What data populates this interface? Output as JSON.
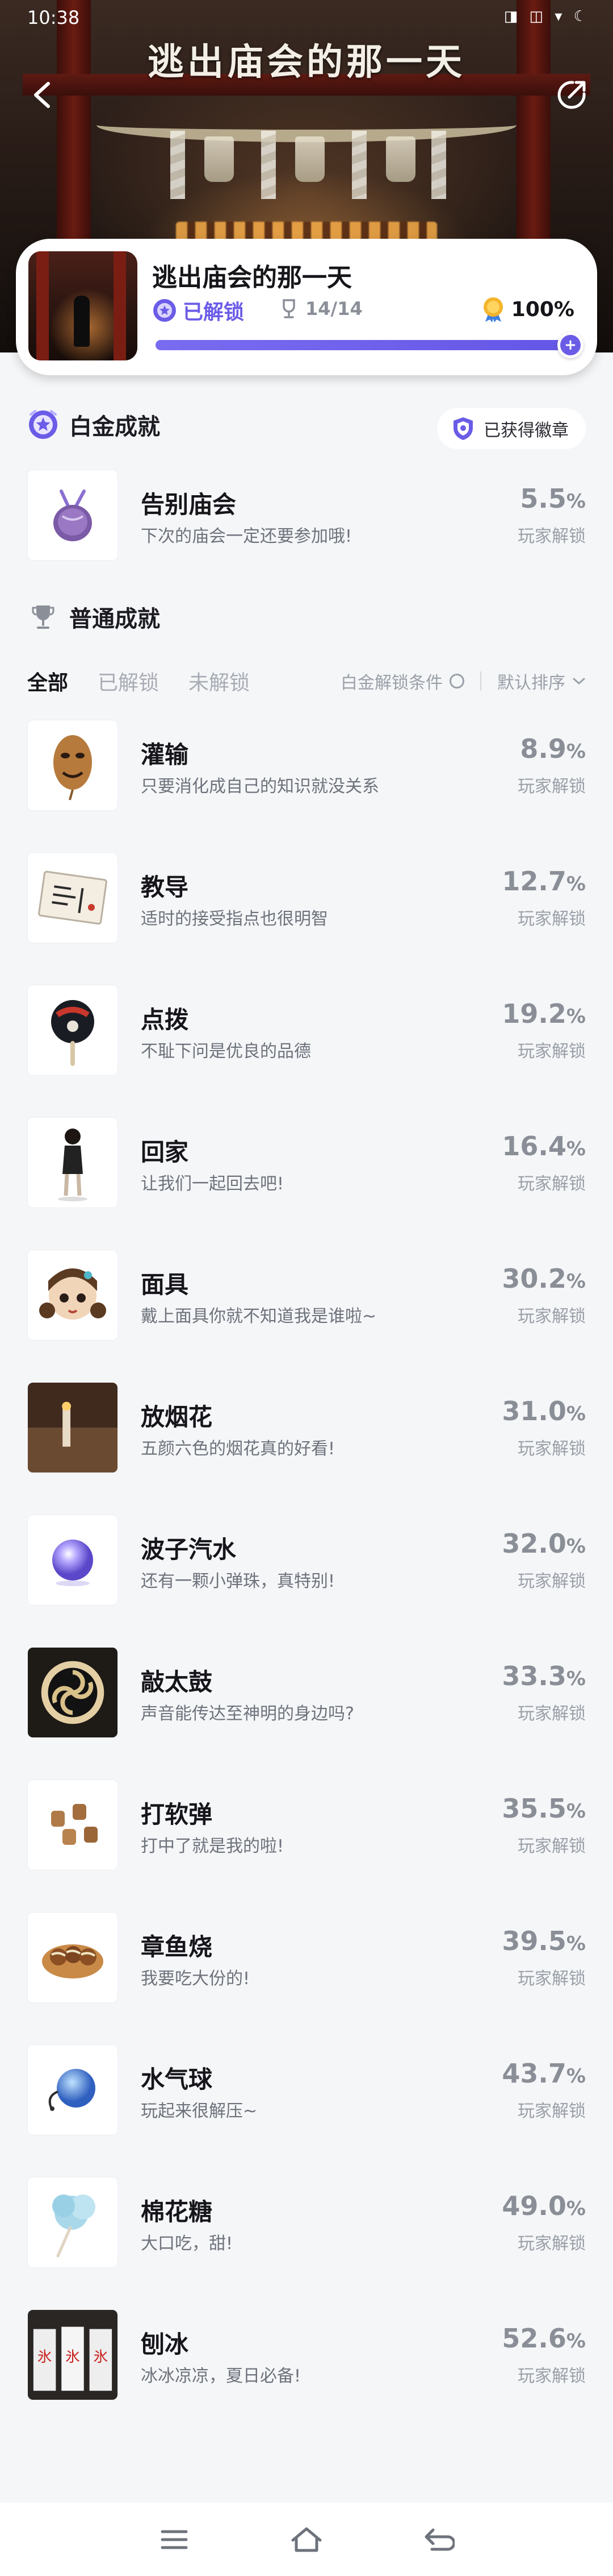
{
  "status_bar": {
    "time": "10:38",
    "icons": "◨ ◫ ▾ ☾"
  },
  "hero": {
    "title": "逃出庙会的那一天"
  },
  "game": {
    "name": "逃出庙会的那一天",
    "unlock_status": "已解锁",
    "trophy_count": "14/14",
    "percent": "100%",
    "progress": 1.0
  },
  "platinum": {
    "heading": "白金成就",
    "badge_button": "已获得徽章",
    "item": {
      "title": "告别庙会",
      "desc": "下次的庙会一定还要参加哦!",
      "rate": "5.5",
      "rate_unit": "%",
      "rate_label": "玩家解锁"
    }
  },
  "normal": {
    "heading": "普通成就",
    "tabs": [
      "全部",
      "已解锁",
      "未解锁"
    ],
    "active_tab": 0,
    "filter_condition": "白金解锁条件",
    "sort": "默认排序",
    "items": [
      {
        "title": "灌输",
        "desc": "只要消化成自己的知识就没关系",
        "rate": "8.9",
        "rate_unit": "%",
        "rate_label": "玩家解锁",
        "icon": "mask-icon"
      },
      {
        "title": "教导",
        "desc": "适时的接受指点也很明智",
        "rate": "12.7",
        "rate_unit": "%",
        "rate_label": "玩家解锁",
        "icon": "note-card-icon"
      },
      {
        "title": "点拨",
        "desc": "不耻下问是优良的品德",
        "rate": "19.2",
        "rate_unit": "%",
        "rate_label": "玩家解锁",
        "icon": "uchiwa-fan-icon"
      },
      {
        "title": "回家",
        "desc": "让我们一起回去吧!",
        "rate": "16.4",
        "rate_unit": "%",
        "rate_label": "玩家解锁",
        "icon": "girl-figure-icon"
      },
      {
        "title": "面具",
        "desc": "戴上面具你就不知道我是谁啦~",
        "rate": "30.2",
        "rate_unit": "%",
        "rate_label": "玩家解锁",
        "icon": "doll-mask-icon"
      },
      {
        "title": "放烟花",
        "desc": "五颜六色的烟花真的好看!",
        "rate": "31.0",
        "rate_unit": "%",
        "rate_label": "玩家解锁",
        "icon": "firework-icon"
      },
      {
        "title": "波子汽水",
        "desc": "还有一颗小弹珠，真特别!",
        "rate": "32.0",
        "rate_unit": "%",
        "rate_label": "玩家解锁",
        "icon": "marble-icon"
      },
      {
        "title": "敲太鼓",
        "desc": "声音能传达至神明的身边吗?",
        "rate": "33.3",
        "rate_unit": "%",
        "rate_label": "玩家解锁",
        "icon": "taiko-drum-icon"
      },
      {
        "title": "打软弹",
        "desc": "打中了就是我的啦!",
        "rate": "35.5",
        "rate_unit": "%",
        "rate_label": "玩家解锁",
        "icon": "corks-icon"
      },
      {
        "title": "章鱼烧",
        "desc": "我要吃大份的!",
        "rate": "39.5",
        "rate_unit": "%",
        "rate_label": "玩家解锁",
        "icon": "takoyaki-icon"
      },
      {
        "title": "水气球",
        "desc": "玩起来很解压~",
        "rate": "43.7",
        "rate_unit": "%",
        "rate_label": "玩家解锁",
        "icon": "water-balloon-icon"
      },
      {
        "title": "棉花糖",
        "desc": "大口吃，甜!",
        "rate": "49.0",
        "rate_unit": "%",
        "rate_label": "玩家解锁",
        "icon": "cotton-candy-icon"
      },
      {
        "title": "刨冰",
        "desc": "冰冰凉凉，夏日必备!",
        "rate": "52.6",
        "rate_unit": "%",
        "rate_label": "玩家解锁",
        "icon": "shaved-ice-icon"
      }
    ]
  },
  "colors": {
    "accent": "#6b5ce7",
    "rate": "#8a8e96",
    "bg": "#f5f6f8"
  },
  "bottom_nav": [
    "menu-icon",
    "home-icon",
    "back-icon"
  ]
}
